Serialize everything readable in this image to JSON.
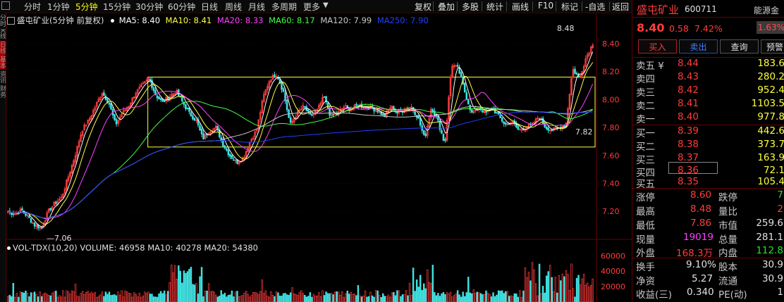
{
  "toolbar": {
    "periods": [
      {
        "label": "分时",
        "active": false
      },
      {
        "label": "1分钟",
        "active": false
      },
      {
        "label": "5分钟",
        "active": true
      },
      {
        "label": "15分钟",
        "active": false
      },
      {
        "label": "30分钟",
        "active": false
      },
      {
        "label": "60分钟",
        "active": false
      },
      {
        "label": "日线",
        "active": false
      },
      {
        "label": "周线",
        "active": false
      },
      {
        "label": "月线",
        "active": false
      },
      {
        "label": "多周期",
        "active": false
      },
      {
        "label": "更多",
        "active": false
      }
    ],
    "tools": [
      "复权",
      "叠加",
      "多股",
      "统计",
      "画线",
      "F10",
      "标记",
      "-自选",
      "返回"
    ]
  },
  "left_tabs": [
    "分时",
    "K线",
    "日线",
    "基本",
    "资讯",
    "财务"
  ],
  "chart": {
    "title": "盛屯矿业(5分钟 前复权)",
    "ma_labels": [
      {
        "text": "MA5: 8.40",
        "color": "#ffffff"
      },
      {
        "text": "MA10: 8.41",
        "color": "#ffff40"
      },
      {
        "text": "MA20: 8.33",
        "color": "#ff40ff"
      },
      {
        "text": "MA60: 8.17",
        "color": "#40ff40"
      },
      {
        "text": "MA120: 7.99",
        "color": "#c8c8c8"
      },
      {
        "text": "MA250: 7.90",
        "color": "#2040ff"
      }
    ],
    "high_label": "8.48",
    "low_label": "7.06",
    "last_label": "7.82",
    "price_ticks": [
      "8.40",
      "8.20",
      "8.00",
      "7.80",
      "7.60",
      "7.40",
      "7.20"
    ],
    "volume_legend": "VOL-TDX(10,20)  VOLUME: 46958  MA10: 40278  MA20: 54380",
    "volume_ticks": [
      "60000",
      "40000",
      "20000"
    ],
    "box_top": 8.16,
    "box_bottom": 7.66
  },
  "chart_data": {
    "type": "candlestick",
    "title": "盛屯矿业(5分钟 前复权)",
    "price_range": [
      7.06,
      8.48
    ],
    "y_ticks": [
      7.2,
      7.4,
      7.6,
      7.8,
      8.0,
      8.2,
      8.4
    ],
    "close_path": [
      7.2,
      7.18,
      7.21,
      7.16,
      7.1,
      7.08,
      7.2,
      7.26,
      7.3,
      7.45,
      7.6,
      7.78,
      7.85,
      7.95,
      8.05,
      7.98,
      7.82,
      7.9,
      7.96,
      8.05,
      8.1,
      8.15,
      8.03,
      7.98,
      8.02,
      8.06,
      7.98,
      7.9,
      7.85,
      7.72,
      7.78,
      7.8,
      7.68,
      7.6,
      7.55,
      7.58,
      7.7,
      7.78,
      8.02,
      8.15,
      8.18,
      8.05,
      7.82,
      7.9,
      7.95,
      7.88,
      7.92,
      8.02,
      7.88,
      7.9,
      7.95,
      7.93,
      7.96,
      7.95,
      7.94,
      7.92,
      7.88,
      7.95,
      7.9,
      7.93,
      7.95,
      7.87,
      7.72,
      7.95,
      7.84,
      7.68,
      8.25,
      8.22,
      8.05,
      7.9,
      7.95,
      7.9,
      7.94,
      7.88,
      7.82,
      7.84,
      7.78,
      7.8,
      7.82,
      7.88,
      7.8,
      7.78,
      7.8,
      7.82,
      8.22,
      8.15,
      8.3,
      8.4
    ],
    "volume_range": [
      0,
      60000
    ],
    "volume_ticks": [
      20000,
      40000,
      60000
    ]
  },
  "quote": {
    "name": "盛屯矿业",
    "code": "600711",
    "source": "能源金",
    "price": "8.40",
    "change": "0.58",
    "change_pct": "7.42%",
    "badge": "1.63%",
    "buttons": [
      "买入",
      "卖出",
      "查询",
      "预警"
    ],
    "asks": [
      {
        "label": "卖五 ¥",
        "price": "8.44",
        "vol": "183.6"
      },
      {
        "label": "卖四",
        "price": "8.43",
        "vol": "280.2"
      },
      {
        "label": "卖三",
        "price": "8.42",
        "vol": "952.4"
      },
      {
        "label": "卖二",
        "price": "8.41",
        "vol": "1103.5"
      },
      {
        "label": "卖一",
        "price": "8.40",
        "vol": "977.8"
      }
    ],
    "bids": [
      {
        "label": "买一",
        "price": "8.39",
        "vol": "442.6"
      },
      {
        "label": "买二",
        "price": "8.38",
        "vol": "373.7"
      },
      {
        "label": "买三",
        "price": "8.37",
        "vol": "163.9"
      },
      {
        "label": "买四",
        "price": "8.36",
        "vol": "72.1"
      },
      {
        "label": "买五",
        "price": "8.35",
        "vol": "105.4"
      }
    ],
    "stats": {
      "limit_up_label": "涨停",
      "limit_up": "8.60",
      "limit_down_label": "跌停",
      "limit_down": "7",
      "high_label": "最高",
      "high": "8.48",
      "vol_ratio_label": "量比",
      "vol_ratio": "2",
      "low_label": "最低",
      "low": "7.86",
      "mktcap_label": "市值",
      "mktcap": "259.6",
      "curvol_label": "现量",
      "curvol": "19019",
      "totvol_label": "总量",
      "totvol": "281.1",
      "outer_label": "外盘",
      "outer": "168.3万",
      "inner_label": "内盘",
      "inner": "112.8",
      "turnover_label": "换手",
      "turnover": "9.10%",
      "shares_label": "股本",
      "shares": "30.9",
      "nav_label": "净资",
      "nav": "5.27",
      "float_label": "流通",
      "float": "30.9",
      "eps_label": "收益(三)",
      "eps": "0.340",
      "pe_label": "PE(动)",
      "pe": "1"
    }
  }
}
